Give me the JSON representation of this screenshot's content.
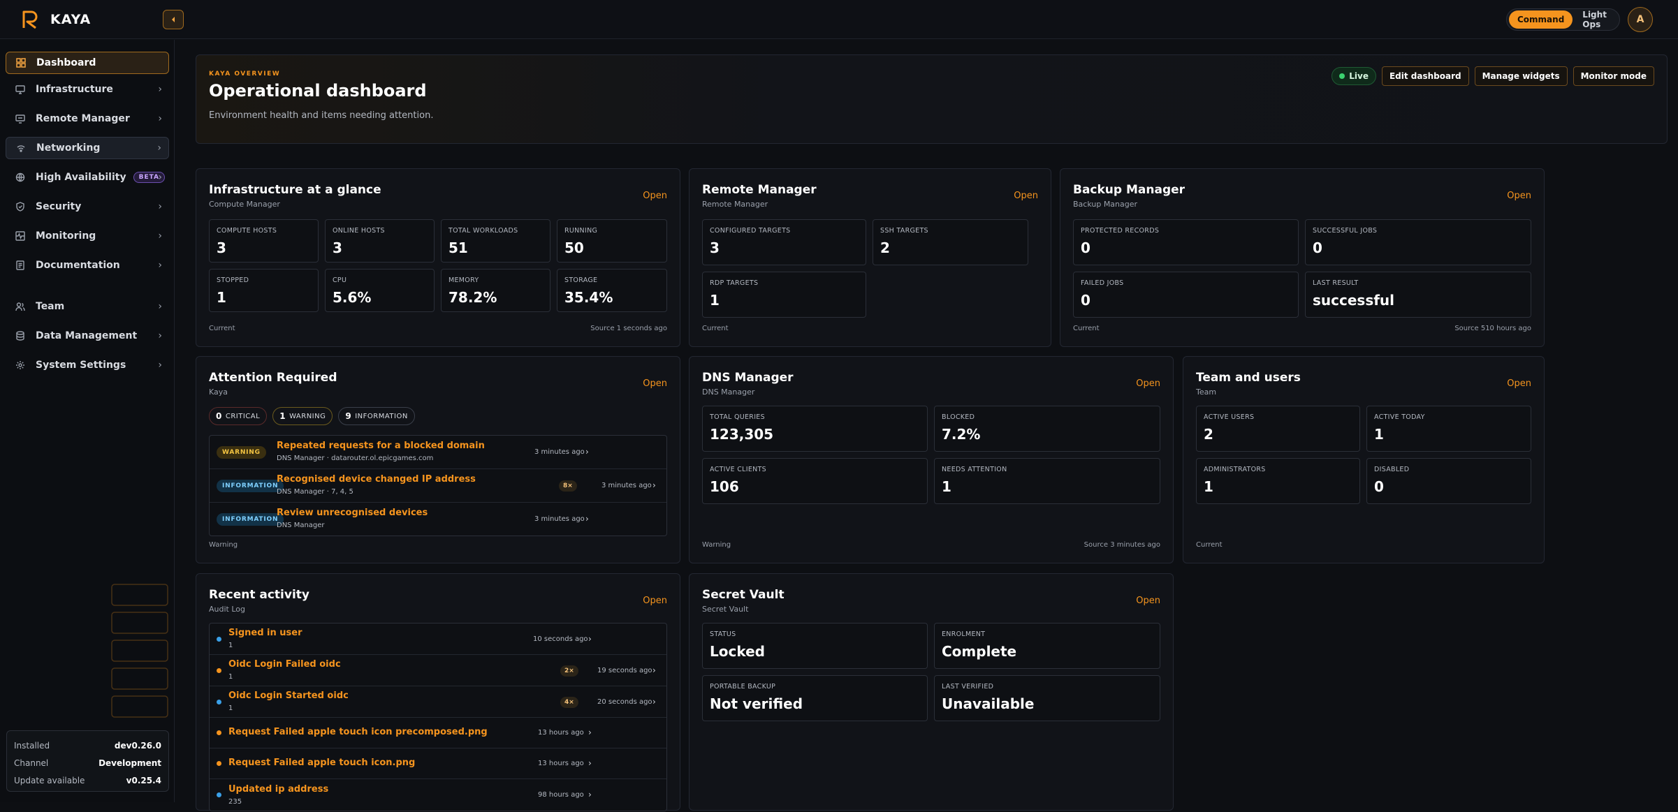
{
  "app": {
    "brand": "KAYA"
  },
  "topbar": {
    "mode_active": "Command",
    "mode_inactive": "Light Ops",
    "avatar_initial": "A"
  },
  "sidebar": {
    "items": [
      {
        "label": "Dashboard",
        "icon": "grid-icon"
      },
      {
        "label": "Infrastructure",
        "icon": "monitor-icon"
      },
      {
        "label": "Remote Manager",
        "icon": "remote-icon"
      },
      {
        "label": "Networking",
        "icon": "wifi-icon"
      },
      {
        "label": "High Availability",
        "icon": "globe-icon",
        "badge": "BETA"
      },
      {
        "label": "Security",
        "icon": "shield-icon"
      },
      {
        "label": "Monitoring",
        "icon": "heartbeat-icon"
      },
      {
        "label": "Documentation",
        "icon": "book-icon"
      },
      {
        "label": "Team",
        "icon": "users-icon"
      },
      {
        "label": "Data Management",
        "icon": "database-icon"
      },
      {
        "label": "System Settings",
        "icon": "gear-icon"
      }
    ],
    "version": [
      {
        "key": "Installed",
        "value": "dev0.26.0"
      },
      {
        "key": "Channel",
        "value": "Development"
      },
      {
        "key": "Update available",
        "value": "v0.25.4"
      }
    ]
  },
  "hero": {
    "eyebrow": "KAYA OVERVIEW",
    "title": "Operational dashboard",
    "subtitle": "Environment health and items needing attention.",
    "live": "Live",
    "actions": [
      "Edit dashboard",
      "Manage widgets",
      "Monitor mode"
    ]
  },
  "open_label": "Open",
  "infra": {
    "title": "Infrastructure at a glance",
    "subtitle": "Compute Manager",
    "stats": [
      {
        "k": "COMPUTE HOSTS",
        "v": "3"
      },
      {
        "k": "ONLINE HOSTS",
        "v": "3"
      },
      {
        "k": "TOTAL WORKLOADS",
        "v": "51"
      },
      {
        "k": "RUNNING",
        "v": "50"
      },
      {
        "k": "STOPPED",
        "v": "1"
      },
      {
        "k": "CPU",
        "v": "5.6%"
      },
      {
        "k": "MEMORY",
        "v": "78.2%"
      },
      {
        "k": "STORAGE",
        "v": "35.4%"
      }
    ],
    "foot_left": "Current",
    "foot_right": "Source 1 seconds ago"
  },
  "remote": {
    "title": "Remote Manager",
    "subtitle": "Remote Manager",
    "stats": [
      {
        "k": "CONFIGURED TARGETS",
        "v": "3"
      },
      {
        "k": "SSH TARGETS",
        "v": "2"
      },
      {
        "k": "RDP TARGETS",
        "v": "1"
      }
    ],
    "foot_left": "Current"
  },
  "backup": {
    "title": "Backup Manager",
    "subtitle": "Backup Manager",
    "stats": [
      {
        "k": "PROTECTED RECORDS",
        "v": "0"
      },
      {
        "k": "SUCCESSFUL JOBS",
        "v": "0"
      },
      {
        "k": "FAILED JOBS",
        "v": "0"
      },
      {
        "k": "LAST RESULT",
        "v": "successful"
      }
    ],
    "foot_left": "Current",
    "foot_right": "Source 510 hours ago"
  },
  "attention": {
    "title": "Attention Required",
    "subtitle": "Kaya",
    "pills": [
      {
        "n": "0",
        "label": "CRITICAL"
      },
      {
        "n": "1",
        "label": "WARNING"
      },
      {
        "n": "9",
        "label": "INFORMATION"
      }
    ],
    "rows": [
      {
        "tag": "WARNING",
        "title": "Repeated requests for a blocked domain",
        "sub": "DNS Manager · datarouter.ol.epicgames.com",
        "time": "3 minutes ago"
      },
      {
        "tag": "INFORMATION",
        "title": "Recognised device changed IP address",
        "sub": "DNS Manager · 7, 4, 5",
        "count": "8×",
        "time": "3 minutes ago"
      },
      {
        "tag": "INFORMATION",
        "title": "Review unrecognised devices",
        "sub": "DNS Manager",
        "time": "3 minutes ago"
      }
    ],
    "foot_left": "Warning"
  },
  "dns": {
    "title": "DNS Manager",
    "subtitle": "DNS Manager",
    "stats": [
      {
        "k": "TOTAL QUERIES",
        "v": "123,305"
      },
      {
        "k": "BLOCKED",
        "v": "7.2%"
      },
      {
        "k": "ACTIVE CLIENTS",
        "v": "106"
      },
      {
        "k": "NEEDS ATTENTION",
        "v": "1"
      }
    ],
    "foot_left": "Warning",
    "foot_right": "Source 3 minutes ago"
  },
  "team": {
    "title": "Team and users",
    "subtitle": "Team",
    "stats": [
      {
        "k": "ACTIVE USERS",
        "v": "2"
      },
      {
        "k": "ACTIVE TODAY",
        "v": "1"
      },
      {
        "k": "ADMINISTRATORS",
        "v": "1"
      },
      {
        "k": "DISABLED",
        "v": "0"
      }
    ],
    "foot_left": "Current"
  },
  "activity": {
    "title": "Recent activity",
    "subtitle": "Audit Log",
    "rows": [
      {
        "title": "Signed in user",
        "sub": "1",
        "time": "10 seconds ago",
        "dot": "#3aa0e8"
      },
      {
        "title": "Oidc Login Failed oidc",
        "sub": "1",
        "count": "2×",
        "time": "19 seconds ago",
        "dot": "#f5941e"
      },
      {
        "title": "Oidc Login Started oidc",
        "sub": "1",
        "count": "4×",
        "time": "20 seconds ago",
        "dot": "#3aa0e8"
      },
      {
        "title": "Request Failed apple touch icon precomposed.png",
        "sub": "",
        "time": "13 hours ago",
        "dot": "#f5941e"
      },
      {
        "title": "Request Failed apple touch icon.png",
        "sub": "",
        "time": "13 hours ago",
        "dot": "#f5941e"
      },
      {
        "title": "Updated ip address",
        "sub": "235",
        "time": "98 hours ago",
        "dot": "#3aa0e8"
      }
    ]
  },
  "vault": {
    "title": "Secret Vault",
    "subtitle": "Secret Vault",
    "stats": [
      {
        "k": "STATUS",
        "v": "Locked"
      },
      {
        "k": "ENROLMENT",
        "v": "Complete"
      },
      {
        "k": "PORTABLE BACKUP",
        "v": "Not verified"
      },
      {
        "k": "LAST VERIFIED",
        "v": "Unavailable"
      }
    ]
  }
}
